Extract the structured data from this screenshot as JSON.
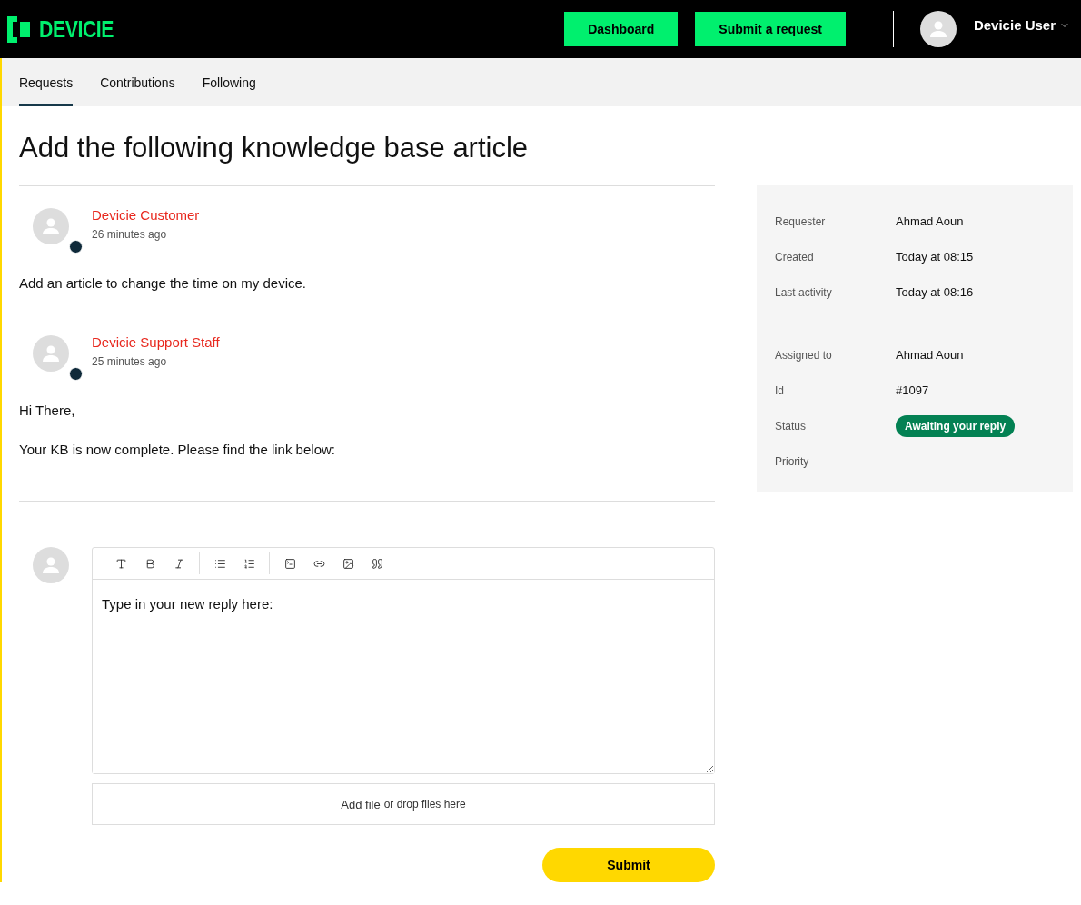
{
  "header": {
    "logo": "DEVICIE",
    "buttons": [
      "Dashboard",
      "Submit a request"
    ],
    "user": "Devicie User"
  },
  "tabs": [
    {
      "label": "Requests",
      "selected": true
    },
    {
      "label": "Contributions",
      "selected": false
    },
    {
      "label": "Following",
      "selected": false
    }
  ],
  "title": "Add the following knowledge base article",
  "comments": [
    {
      "author": "Devicie Customer",
      "time": "26 minutes ago",
      "paragraphs": [
        "Add an article to change the time on my device."
      ]
    },
    {
      "author": "Devicie Support Staff",
      "time": "25 minutes ago",
      "paragraphs": [
        "Hi There,",
        "Your KB is now complete. Please find the link below:"
      ]
    }
  ],
  "reply": {
    "value": "Type in your new reply here:",
    "attach_link": "Add file",
    "attach_text": "or drop files here",
    "submit": "Submit"
  },
  "details": [
    [
      {
        "kind": "text",
        "label": "Requester",
        "value": "Ahmad Aoun"
      },
      {
        "kind": "text",
        "label": "Created",
        "value": "Today at 08:15"
      },
      {
        "kind": "text",
        "label": "Last activity",
        "value": "Today at 08:16"
      }
    ],
    [
      {
        "kind": "text",
        "label": "Assigned to",
        "value": "Ahmad Aoun"
      },
      {
        "kind": "text",
        "label": "Id",
        "value": "#1097"
      },
      {
        "kind": "badge",
        "label": "Status",
        "value": "Awaiting your reply"
      },
      {
        "kind": "text",
        "label": "Priority",
        "value": "—"
      }
    ]
  ]
}
